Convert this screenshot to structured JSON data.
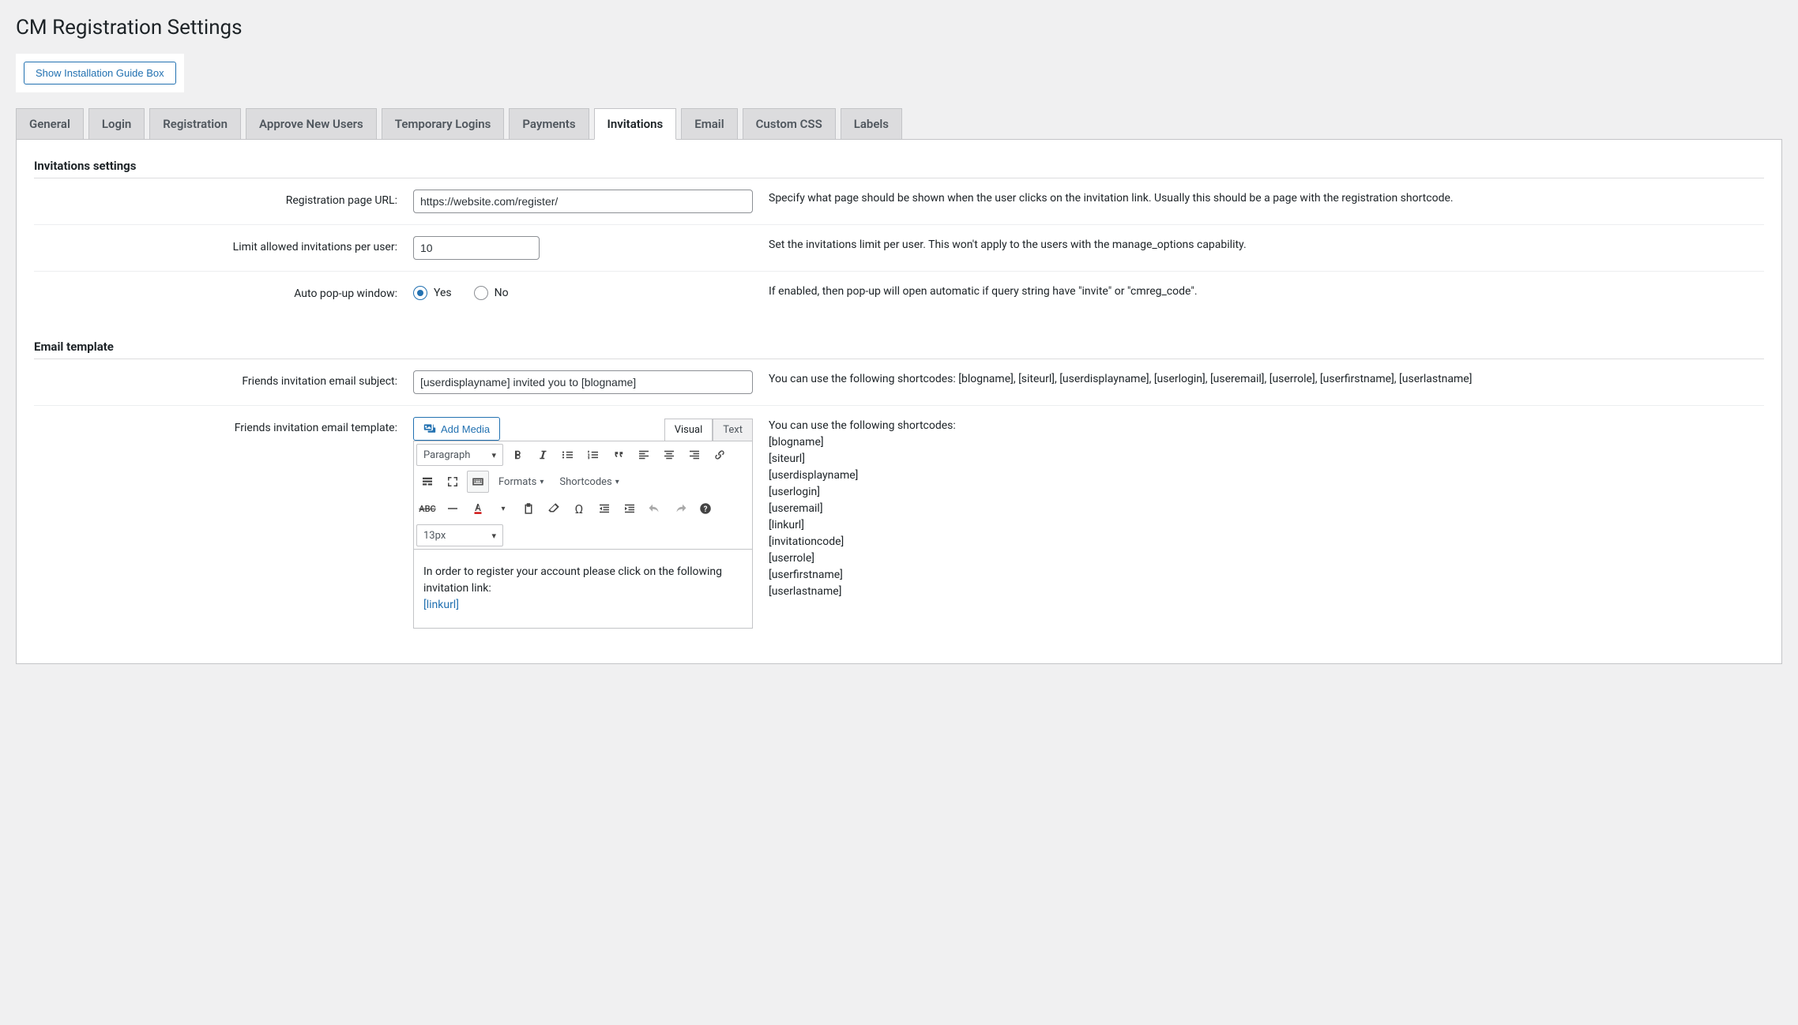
{
  "page_title": "CM Registration Settings",
  "guide_button": "Show Installation Guide Box",
  "tabs": {
    "general": "General",
    "login": "Login",
    "registration": "Registration",
    "approve": "Approve New Users",
    "temp": "Temporary Logins",
    "payments": "Payments",
    "invitations": "Invitations",
    "email": "Email",
    "custom_css": "Custom CSS",
    "labels": "Labels"
  },
  "sections": {
    "invitations_title": "Invitations settings",
    "email_template_title": "Email template"
  },
  "fields": {
    "reg_url": {
      "label": "Registration page URL:",
      "value": "https://website.com/register/",
      "help": "Specify what page should be shown when the user clicks on the invitation link. Usually this should be a page with the registration shortcode."
    },
    "limit": {
      "label": "Limit allowed invitations per user:",
      "value": "10",
      "help": "Set the invitations limit per user. This won't apply to the users with the manage_options capability."
    },
    "popup": {
      "label": "Auto pop-up window:",
      "yes": "Yes",
      "no": "No",
      "help": "If enabled, then pop-up will open automatic if query string have \"invite\" or \"cmreg_code\"."
    },
    "subject": {
      "label": "Friends invitation email subject:",
      "value": "[userdisplayname] invited you to [blogname]",
      "help": "You can use the following shortcodes: [blogname], [siteurl], [userdisplayname], [userlogin], [useremail], [userrole], [userfirstname], [userlastname]"
    },
    "template": {
      "label": "Friends invitation email template:",
      "add_media": "Add Media",
      "visual_tab": "Visual",
      "text_tab": "Text",
      "paragraph": "Paragraph",
      "formats": "Formats",
      "shortcodes": "Shortcodes",
      "font_size": "13px",
      "content_text": "In order to register your account please click on the following invitation link:",
      "content_link": "[linkurl]",
      "help_head": "You can use the following shortcodes:",
      "help_codes": [
        "[blogname]",
        "[siteurl]",
        "[userdisplayname]",
        "[userlogin]",
        "[useremail]",
        "[linkurl]",
        "[invitationcode]",
        "[userrole]",
        "[userfirstname]",
        "[userlastname]"
      ]
    }
  }
}
